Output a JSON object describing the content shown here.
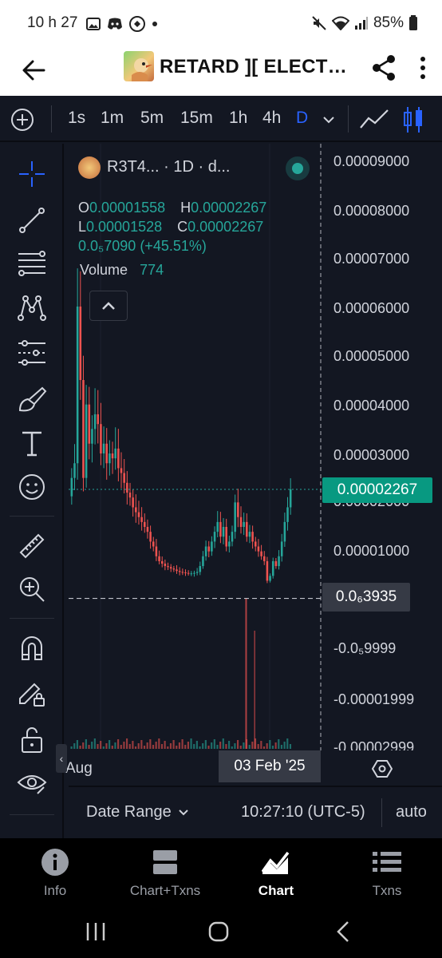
{
  "status_bar": {
    "time": "10 h 27",
    "battery": "85%",
    "icons_left": [
      "image-icon",
      "discord-icon",
      "crypto-app-icon",
      "dot-icon"
    ],
    "icons_right": [
      "mute-icon",
      "wifi-icon",
      "signal-icon",
      "battery-icon"
    ]
  },
  "header": {
    "title": "RETARD ][ ELECTRI...",
    "back_icon": "arrow-left-icon",
    "share_icon": "share-icon",
    "menu_icon": "more-vertical-icon"
  },
  "timeframes": {
    "items": [
      "1s",
      "1m",
      "5m",
      "15m",
      "1h",
      "4h",
      "D"
    ],
    "active": "D"
  },
  "legend": {
    "title": "R3T4...   · 1D · d...",
    "ohlc": {
      "o_label": "O",
      "o": "0.00001558",
      "h_label": "H",
      "h": "0.00002267",
      "l_label": "L",
      "l": "0.00001528",
      "c_label": "C",
      "c": "0.00002267",
      "change": "0.0₅7090 (+45.51%)"
    },
    "volume_label": "Volume",
    "volume_value": "774"
  },
  "price_axis": {
    "labels": [
      "0.00009000",
      "0.00008000",
      "0.00007000",
      "0.00006000",
      "0.00005000",
      "0.00004000",
      "0.00003000",
      "0.00002000",
      "0.00001000",
      "-0.0₅9999",
      "-0.00001999",
      "-0.00002999"
    ],
    "current_price": "0.00002267",
    "crosshair_price": "0.0₆3935"
  },
  "time_axis": {
    "labels": [
      "Aug"
    ],
    "crosshair_date": "03 Feb '25"
  },
  "bottom_bar": {
    "date_range": "Date Range",
    "clock": "10:27:10 (UTC-5)",
    "auto": "auto"
  },
  "tabs": [
    {
      "label": "Info",
      "icon": "info-icon"
    },
    {
      "label": "Chart+Txns",
      "icon": "chart-txns-icon"
    },
    {
      "label": "Chart",
      "icon": "chart-icon",
      "active": true
    },
    {
      "label": "Txns",
      "icon": "list-icon"
    }
  ],
  "colors": {
    "up": "#26a69a",
    "down": "#ef5350",
    "background": "#131722",
    "accent": "#2962ff",
    "price_tag": "#089981"
  },
  "chart_data": {
    "type": "candlestick",
    "interval": "1D",
    "x_start_label": "Aug",
    "crosshair_date": "03 Feb '25",
    "ylim": [
      -3e-05,
      9e-05
    ],
    "close": [
      2.5e-05,
      2.8e-05,
      6e-05,
      4.5e-05,
      2.5e-05,
      4e-05,
      3.2e-05,
      3.5e-05,
      3.8e-05,
      3.6e-05,
      3e-05,
      3.2e-05,
      2.8e-05,
      3e-05,
      2.9e-05,
      3.1e-05,
      2.7e-05,
      2.6e-05,
      2.4e-05,
      2.2e-05,
      2.1e-05,
      1.9e-05,
      1.8e-05,
      1.7e-05,
      1.6e-05,
      1.5e-05,
      1.4e-05,
      1.2e-05,
      1.1e-05,
      9e-06,
      8e-06,
      7.5e-06,
      7e-06,
      6.8e-06,
      6.5e-06,
      6.3e-06,
      6e-06,
      5.8e-06,
      5.7e-06,
      5.6e-06,
      5.5e-06,
      5.5e-06,
      5.6e-06,
      5.8e-06,
      7e-06,
      9e-06,
      1.1e-05,
      1e-05,
      1.2e-05,
      1.4e-05,
      1.6e-05,
      1.3e-05,
      1.5e-05,
      1.1e-05,
      1.2e-05,
      1.4e-05,
      2e-05,
      1.7e-05,
      1.5e-05,
      1.6e-05,
      1.3e-05,
      1.4e-05,
      1.2e-05,
      1.1e-05,
      1e-05,
      9e-06,
      8e-06,
      4e-06,
      5e-06,
      8e-06,
      7e-06,
      9e-06,
      1.2e-05,
      1.6e-05,
      1.9e-05,
      2.267e-05
    ],
    "volume_spikes": [
      {
        "index": 60,
        "value": 774
      }
    ],
    "last_price": 2.267e-05,
    "crosshair_price": 3.935e-07
  }
}
